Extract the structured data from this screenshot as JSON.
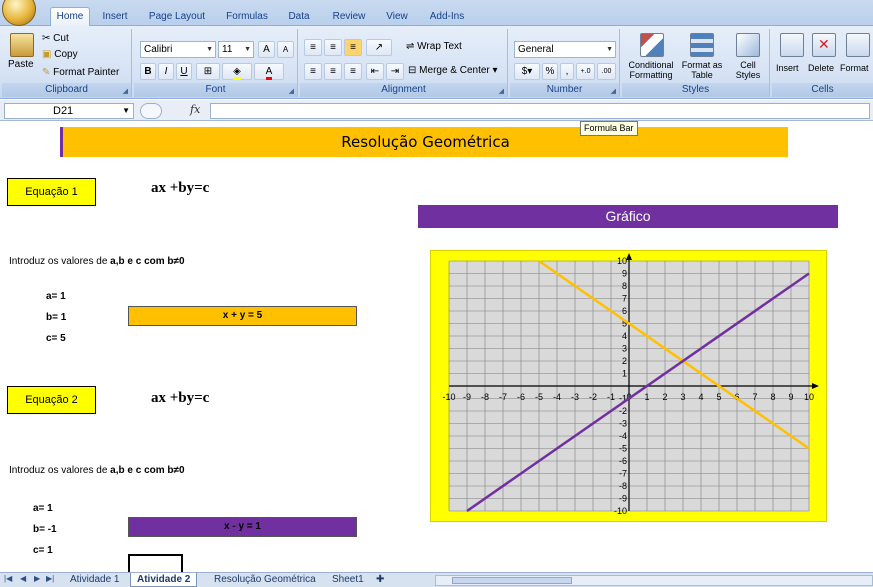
{
  "ribbon": {
    "tabs": [
      "Home",
      "Insert",
      "Page Layout",
      "Formulas",
      "Data",
      "Review",
      "View",
      "Add-Ins"
    ],
    "clipboard": {
      "paste": "Paste",
      "cut": "Cut",
      "copy": "Copy",
      "format_painter": "Format Painter",
      "label": "Clipboard"
    },
    "font": {
      "name": "Calibri",
      "size": "11",
      "label": "Font",
      "bold": "B",
      "italic": "I",
      "underline": "U"
    },
    "alignment": {
      "wrap_text": "Wrap Text",
      "merge_center": "Merge & Center",
      "label": "Alignment"
    },
    "number": {
      "format": "General",
      "label": "Number",
      "percent": "%",
      "comma": ",",
      "inc": "+.0 .00",
      "dec": ".00 ->.0"
    },
    "styles": {
      "conditional": "Conditional Formatting",
      "format_table": "Format as Table",
      "cell_styles": "Cell Styles",
      "label": "Styles"
    },
    "cells": {
      "insert": "Insert",
      "delete": "Delete",
      "format": "Format",
      "label": "Cells"
    }
  },
  "formula_bar": {
    "name_box": "D21",
    "fx": "fx",
    "value": "",
    "tooltip": "Formula Bar"
  },
  "sheet": {
    "title": "Resolução Geométrica",
    "eq1": {
      "label": "Equação 1",
      "formula": "ax +by=c",
      "intro_prefix": "Introduz os valores de ",
      "intro_bold": "a,b e c com b≠0",
      "a": "a= 1",
      "b": "b= 1",
      "c": "c= 5",
      "result": "x + y = 5"
    },
    "eq2": {
      "label": "Equação 2",
      "formula": "ax +by=c",
      "intro_prefix": "Introduz os valores de ",
      "intro_bold": "a,b e c com b≠0",
      "a": "a= 1",
      "b": "b= -1",
      "c": "c= 1",
      "result": "x - y = 1"
    },
    "chart_header": "Gráfico"
  },
  "chart_data": {
    "type": "line",
    "xlim": [
      -10,
      10
    ],
    "ylim": [
      -10,
      10
    ],
    "grid": true,
    "x_ticks": [
      "-10",
      "-9",
      "-8",
      "-7",
      "-6",
      "-5",
      "-4",
      "-3",
      "-2",
      "-1",
      "0",
      "1",
      "2",
      "3",
      "4",
      "5",
      "6",
      "7",
      "8",
      "9",
      "10"
    ],
    "y_ticks": [
      "10",
      "9",
      "8",
      "7",
      "6",
      "5",
      "4",
      "3",
      "2",
      "1",
      "0",
      "-1",
      "-2",
      "-3",
      "-4",
      "-5",
      "-6",
      "-7",
      "-8",
      "-9",
      "-10"
    ],
    "series": [
      {
        "color": "#ffc000",
        "x": [
          -5,
          10
        ],
        "y": [
          10,
          -5
        ]
      },
      {
        "color": "#7030a0",
        "x": [
          -9,
          10
        ],
        "y": [
          -10,
          9
        ]
      }
    ]
  },
  "sheet_tabs": {
    "tabs": [
      "Atividade 1",
      "Atividade 2",
      "Resolução Geométrica",
      "Sheet1"
    ],
    "active": "Atividade 2"
  },
  "colors": {
    "banner": "#ffc000",
    "header": "#7030a0",
    "eqbox": "#ffff00",
    "graph_bg": "#ffff00"
  }
}
